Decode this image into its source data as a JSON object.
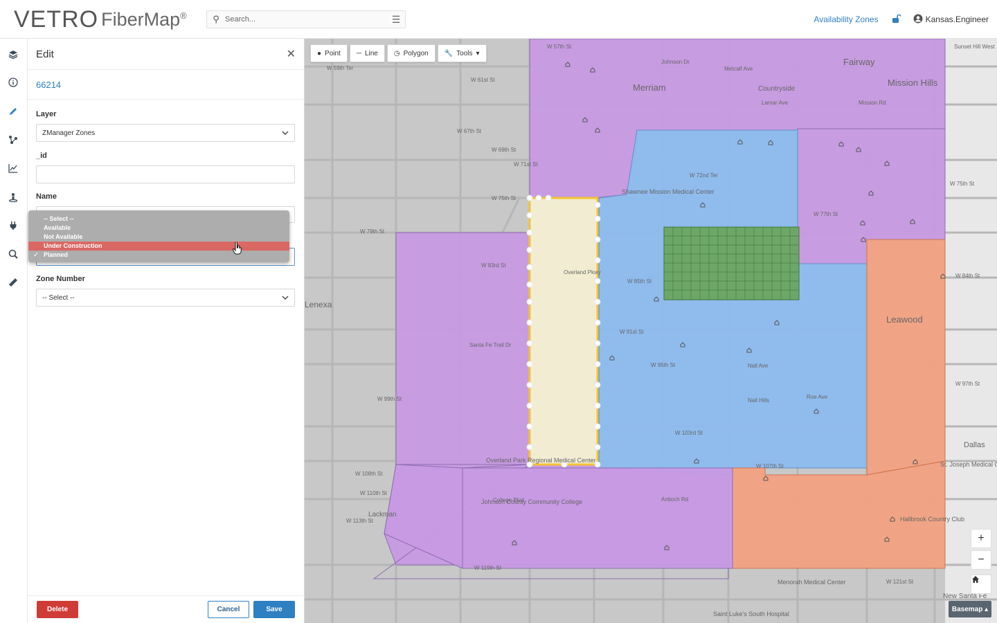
{
  "header": {
    "logo_main": "VETRO",
    "logo_sub": "FiberMap",
    "logo_reg": "®",
    "search_placeholder": "Search...",
    "zones_link": "Availability Zones",
    "user": "Kansas.Engineer"
  },
  "panel": {
    "title": "Edit",
    "record_id": "66214",
    "layer_label": "Layer",
    "layer_value": "ZManager Zones",
    "id_label": "_id",
    "name_label": "Name",
    "zone_number_label": "Zone Number",
    "zone_number_value": "-- Select --",
    "status_options": [
      "-- Select --",
      "Available",
      "Not Available",
      "Under Construction",
      "Planned"
    ],
    "status_highlighted": "Under Construction",
    "status_checked": "Planned",
    "delete_label": "Delete",
    "cancel_label": "Cancel",
    "save_label": "Save"
  },
  "map": {
    "tools": {
      "point": "Point",
      "line": "Line",
      "polygon": "Polygon",
      "tools": "Tools"
    },
    "basemap_label": "Basemap",
    "zoom_in": "+",
    "zoom_out": "−",
    "place_labels": [
      "Merriam",
      "Fairway",
      "Mission Hills",
      "Countryside",
      "Leawood",
      "Lenexa",
      "Dallas",
      "Shawnee Mission Medical Center",
      "Overland Park Regional Medical Center",
      "Johnson County Community College",
      "St. Joseph Medical Center",
      "Hallbrook Country Club",
      "Menorah Medical Center",
      "New Santa Fe",
      "Saint Luke's South Hospital",
      "Lackman",
      "Sunset Hill West",
      "Nall Hills"
    ],
    "street_labels": [
      "W 57th St",
      "W 59th Ter",
      "W 61st St",
      "W 67th St",
      "W 69th St",
      "W 71st St",
      "W 75th St",
      "W 79th St",
      "W 83rd St",
      "W 85th St",
      "W 91st St",
      "W 95th St",
      "W 99th St",
      "W 103rd St",
      "W 107th St",
      "W 108th St",
      "W 110th St",
      "W 113th St",
      "W 119th St",
      "College Blvd",
      "Santa Fe Trail Dr",
      "Overland Pkwy",
      "Metcalf Ave",
      "Antioch Rd",
      "Nall Ave",
      "Roe Ave",
      "Johnson Dr",
      "W 72nd Ter",
      "W 77th St",
      "Lamar Ave",
      "Mission Rd",
      "W 84th St",
      "W 97th St",
      "W 121st St",
      "W 75th St"
    ],
    "colors": {
      "purple": "#c79ae3",
      "blue": "#8dbbef",
      "orange": "#f2a282",
      "yellow": "#f4efd3",
      "green": "#6ea667",
      "selection": "#f3c334"
    }
  }
}
